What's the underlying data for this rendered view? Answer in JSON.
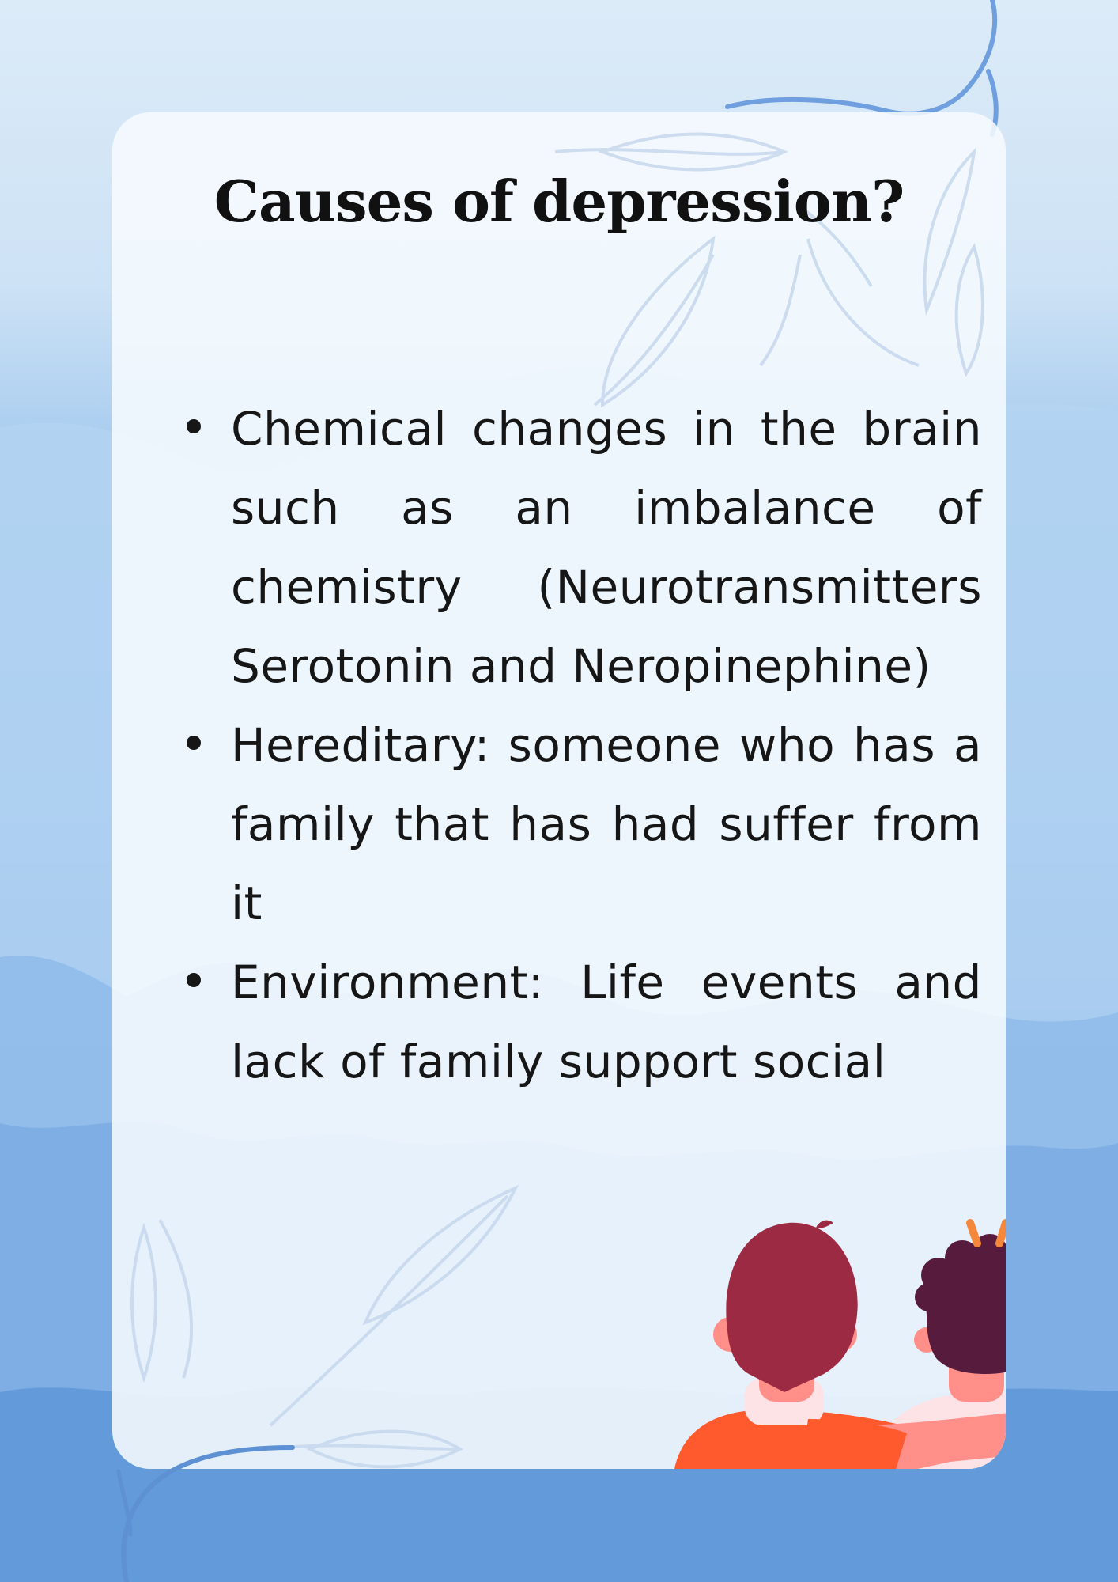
{
  "title": "Causes of depression?",
  "bullets": [
    "Chemical changes in the brain such as an imbalance of chemistry (Neurotransmitters Serotonin and Neropinephine)",
    "Hereditary: someone who has a family that has had suffer from it",
    "Environment: Life events and lack of family support social"
  ],
  "colors": {
    "background_top": "#dcebf8",
    "background_bottom": "#6aa2e0",
    "card": "#f6fafe",
    "title": "#111111",
    "text": "#161616",
    "vine": "#6f9fde",
    "shirt_left": "#ff5a2e",
    "hair_left": "#9c2a42",
    "hair_right": "#571b3d",
    "shirt_right": "#fde3e6",
    "alert_marks": "#f4873a"
  },
  "icons": [
    "leaf-vine-icon",
    "friends-hugging-illustration"
  ]
}
